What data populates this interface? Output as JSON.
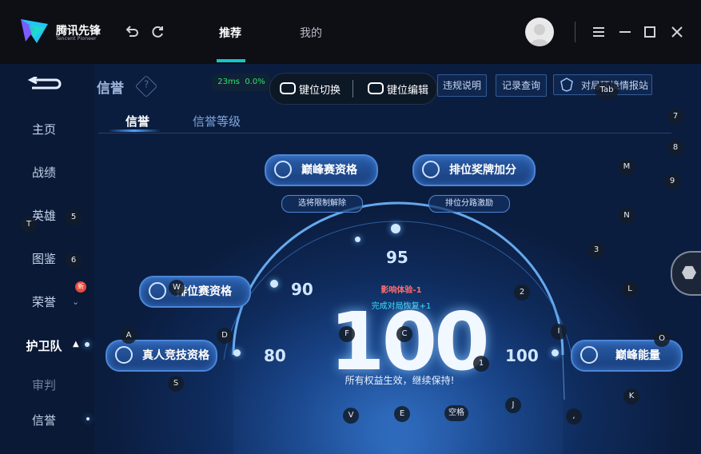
{
  "titlebar": {
    "logo_cn": "腾讯先锋",
    "logo_en": "Tencent Pioneer",
    "nav_tabs": [
      {
        "label": "推荐",
        "active": true
      },
      {
        "label": "我的",
        "active": false
      }
    ],
    "icons": [
      "back-icon",
      "refresh-icon",
      "avatar",
      "menu-icon",
      "minimize-icon",
      "maximize-icon",
      "close-icon"
    ]
  },
  "game_header": {
    "title": "信誉",
    "ping": "23ms",
    "loss": "0.0%",
    "key_switch": "键位切换",
    "key_edit": "键位编辑",
    "buttons": [
      "违规说明",
      "记录查询",
      "对局环境情报站"
    ]
  },
  "sidebar": {
    "items": [
      {
        "label": "主页"
      },
      {
        "label": "战绩"
      },
      {
        "label": "英雄"
      },
      {
        "label": "图鉴"
      },
      {
        "label": "荣誉"
      },
      {
        "label": "护卫队"
      },
      {
        "label": "审判"
      },
      {
        "label": "信誉"
      }
    ],
    "new_badge": "新"
  },
  "sub_tabs": [
    {
      "label": "信誉",
      "active": true
    },
    {
      "label": "信誉等级",
      "active": false
    }
  ],
  "qualifications": {
    "peak_match": "巅峰赛资格",
    "peak_match_sub": "选将限制解除",
    "rank_bonus": "排位奖牌加分",
    "rank_bonus_sub": "排位分路激励",
    "rank_match": "排位赛资格",
    "real_person": "真人竞技资格",
    "peak_energy": "巅峰能量"
  },
  "score_arc": {
    "markers": [
      "80",
      "90",
      "95",
      "100"
    ],
    "score": "100",
    "impact": "影响体验-1",
    "recovery": "完成对局恢复+1",
    "message": "所有权益生效，继续保持!"
  },
  "overlay_keys": [
    "Tab",
    "7",
    "8",
    "M",
    "9",
    "N",
    "3",
    "L",
    "2",
    "I",
    "O",
    "K",
    "J",
    ",",
    "空格",
    "E",
    "V",
    "1",
    "C",
    "F",
    "W",
    "A",
    "D",
    "S",
    "T",
    "5",
    "6"
  ],
  "colors": {
    "accent": "#19c3c9",
    "ping_green": "#2ee36e",
    "impact_red": "#ff6b6b",
    "recovery_cyan": "#38e0ff",
    "new_badge": "#e84a3a"
  }
}
